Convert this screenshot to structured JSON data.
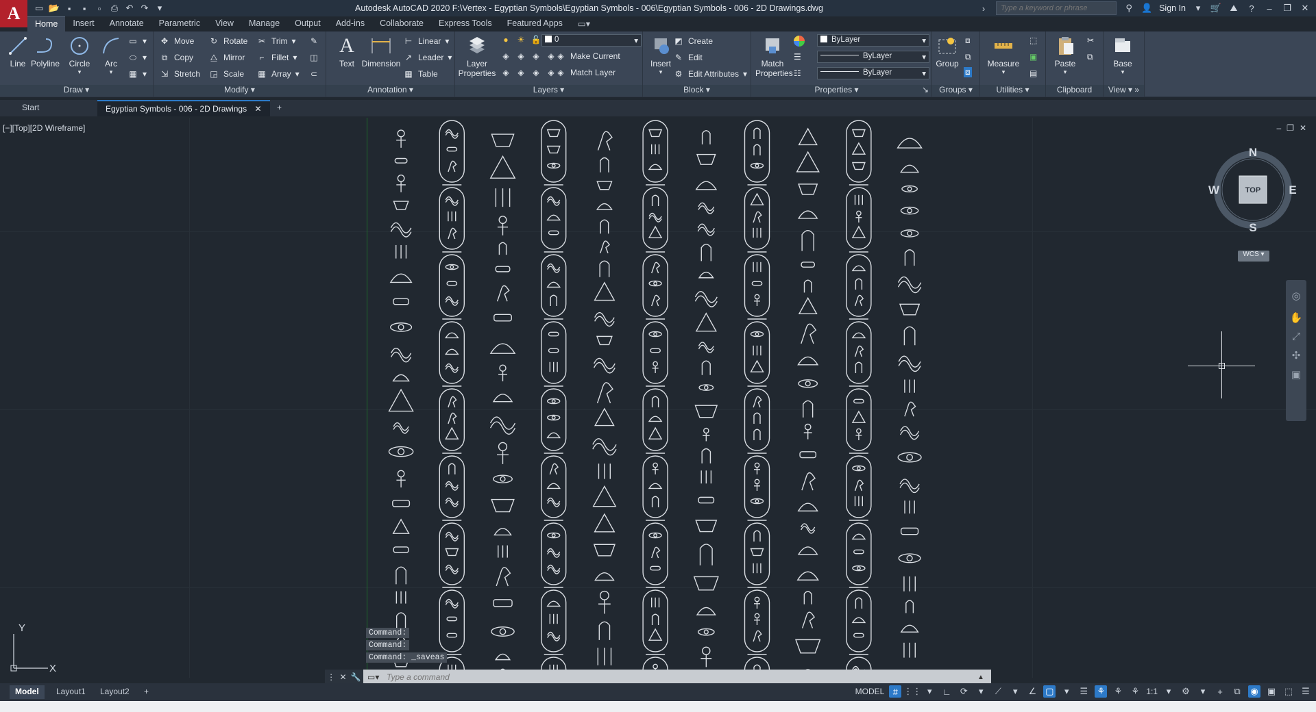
{
  "app": {
    "logo_letter": "A",
    "title": "Autodesk AutoCAD 2020   F:\\Vertex - Egyptian Symbols\\Egyptian Symbols - 006\\Egyptian Symbols - 006 - 2D Drawings.dwg",
    "search_placeholder": "Type a keyword or phrase",
    "sign_in": "Sign In",
    "accent_color": "#2d7ac8",
    "brand_color": "#b3212b"
  },
  "ribbon": {
    "tabs": [
      "Home",
      "Insert",
      "Annotate",
      "Parametric",
      "View",
      "Manage",
      "Output",
      "Add-ins",
      "Collaborate",
      "Express Tools",
      "Featured Apps"
    ],
    "active_tab": "Home",
    "draw": {
      "title": "Draw",
      "line": "Line",
      "polyline": "Polyline",
      "circle": "Circle",
      "arc": "Arc"
    },
    "modify": {
      "title": "Modify",
      "move": "Move",
      "rotate": "Rotate",
      "trim": "Trim",
      "copy": "Copy",
      "mirror": "Mirror",
      "fillet": "Fillet",
      "stretch": "Stretch",
      "scale": "Scale",
      "array": "Array"
    },
    "annotation": {
      "title": "Annotation",
      "text": "Text",
      "dimension": "Dimension",
      "linear": "Linear",
      "leader": "Leader",
      "table": "Table"
    },
    "layers": {
      "title": "Layers",
      "layer_properties_1": "Layer",
      "layer_properties_2": "Properties",
      "current_layer": "0",
      "make_current": "Make Current",
      "match_layer": "Match Layer"
    },
    "block": {
      "title": "Block",
      "insert": "Insert",
      "create": "Create",
      "edit": "Edit",
      "edit_attributes": "Edit Attributes"
    },
    "properties": {
      "title": "Properties",
      "match_1": "Match",
      "match_2": "Properties",
      "color": "ByLayer",
      "linetype": "ByLayer",
      "lineweight": "ByLayer"
    },
    "groups": {
      "title": "Groups",
      "group": "Group"
    },
    "utilities": {
      "title": "Utilities",
      "measure": "Measure"
    },
    "clipboard": {
      "title": "Clipboard",
      "paste": "Paste"
    },
    "view": {
      "title": "View",
      "base": "Base"
    }
  },
  "file_tabs": {
    "start": "Start",
    "active": "Egyptian Symbols - 006 - 2D Drawings"
  },
  "viewport": {
    "label": "[−][Top][2D Wireframe]",
    "compass": {
      "n": "N",
      "s": "S",
      "e": "E",
      "w": "W",
      "top": "TOP"
    },
    "wcs": "WCS",
    "ucs_x": "X",
    "ucs_y": "Y"
  },
  "command": {
    "history": [
      "Command:",
      "Command:",
      "Command: _saveas"
    ],
    "placeholder": "Type a command"
  },
  "layout_tabs": [
    "Model",
    "Layout1",
    "Layout2"
  ],
  "status": {
    "model": "MODEL",
    "scale": "1:1"
  }
}
